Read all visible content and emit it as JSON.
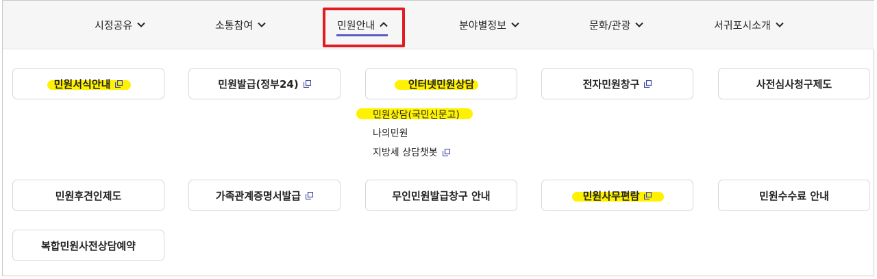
{
  "nav": {
    "items": [
      {
        "label": "시정공유"
      },
      {
        "label": "소통참여"
      },
      {
        "label": "민원안내"
      },
      {
        "label": "분야별정보"
      },
      {
        "label": "문화/관광"
      },
      {
        "label": "서귀포시소개"
      }
    ],
    "active_index": 2
  },
  "menu": {
    "row1": [
      {
        "label": "민원서식안내"
      },
      {
        "label": "민원발급(정부24)"
      },
      {
        "label": "인터넷민원상담"
      },
      {
        "label": "전자민원창구"
      },
      {
        "label": "사전심사청구제도"
      }
    ],
    "submenu": [
      {
        "label": "민원상담(국민신문고)"
      },
      {
        "label": "나의민원"
      },
      {
        "label": "지방세 상담챗봇"
      }
    ],
    "row2": [
      {
        "label": "민원후견인제도"
      },
      {
        "label": "가족관계증명서발급"
      },
      {
        "label": "무인민원발급창구 안내"
      },
      {
        "label": "민원사무편람"
      },
      {
        "label": "민원수수료 안내"
      }
    ],
    "row3": [
      {
        "label": "복합민원사전상담예약"
      }
    ]
  },
  "colors": {
    "highlight": "#fff200",
    "active_border": "#e01b22",
    "active_underline": "#5b57c8",
    "external_icon": "#3f4aa8"
  }
}
